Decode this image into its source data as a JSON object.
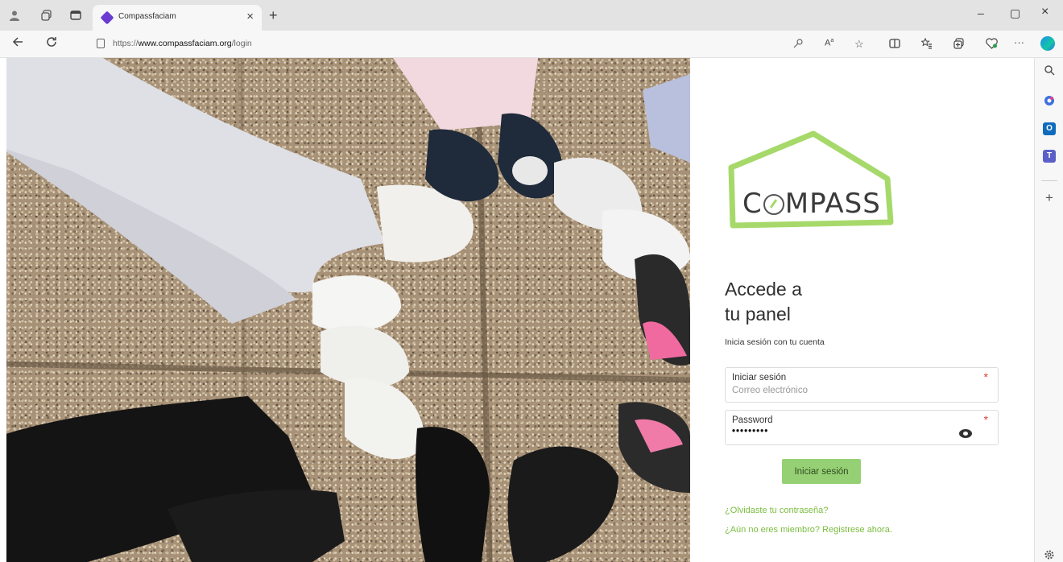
{
  "browser": {
    "tab_title": "Compassfaciam",
    "url_prefix": "https://",
    "url_domain": "www.compassfaciam.org",
    "url_path": "/login",
    "tab_close": "×",
    "new_tab": "+",
    "more_tools": "···",
    "window_controls": {
      "minimize": "–",
      "maximize": "▢",
      "close": "×"
    }
  },
  "sidebar": {
    "add": "+"
  },
  "login": {
    "logo_prefix": "C",
    "logo_suffix": "MPASS",
    "heading_line1": "Accede a",
    "heading_line2": "tu panel",
    "subtitle": "Inicia sesión con tu cuenta",
    "email_label": "Iniciar sesión",
    "email_placeholder": "Correo electrónico",
    "password_label": "Password",
    "password_value": "•••••••••",
    "required_mark": "*",
    "submit_label": "Iniciar sesión",
    "forgot_link": "¿Olvidaste tu contraseña?",
    "register_link": "¿Aún no eres miembro? Registrese ahora."
  },
  "colors": {
    "accent_green": "#96d075",
    "link_green": "#7bbd3f",
    "logo_green": "#a6d96a",
    "required_red": "#e53935"
  }
}
